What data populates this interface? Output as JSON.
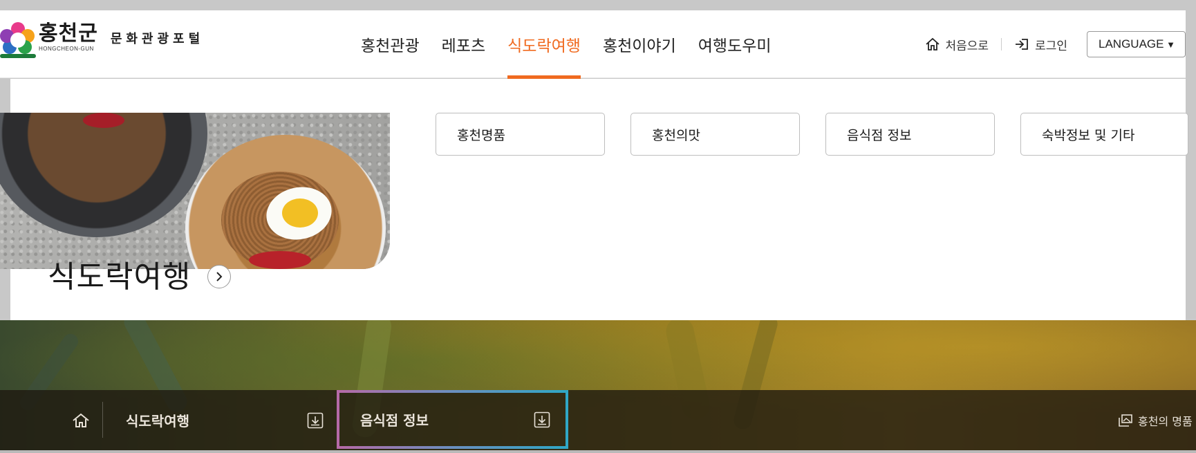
{
  "header": {
    "logo_title": "홍천군",
    "logo_subtitle": "HONGCHEON-GUN",
    "logo_portal": "문화관광포털",
    "nav": [
      {
        "label": "홍천관광",
        "active": false
      },
      {
        "label": "레포츠",
        "active": false
      },
      {
        "label": "식도락여행",
        "active": true
      },
      {
        "label": "홍천이야기",
        "active": false
      },
      {
        "label": "여행도우미",
        "active": false
      }
    ],
    "util": {
      "home_label": "처음으로",
      "home_icon": "home-icon",
      "login_label": "로그인",
      "login_icon": "login-icon",
      "language_label": "LANGUAGE",
      "language_caret": "▼"
    }
  },
  "panel": {
    "title": "식도락여행",
    "arrow_icon": "chevron-right-icon",
    "submenu": [
      "홍천명품",
      "홍천의맛",
      "음식점 정보",
      "숙박정보 및 기타"
    ]
  },
  "location": {
    "home_icon": "home-icon",
    "level1": "식도락여행",
    "level1_icon": "download-icon",
    "level2": "음식점 정보",
    "level2_icon": "download-icon",
    "side_link": "홍천의 명품",
    "side_icon": "gallery-icon"
  },
  "colors": {
    "accent": "#f06a1f",
    "focus_border": [
      "#b66aa8",
      "#6a8fc0",
      "#2fa7c6"
    ]
  }
}
